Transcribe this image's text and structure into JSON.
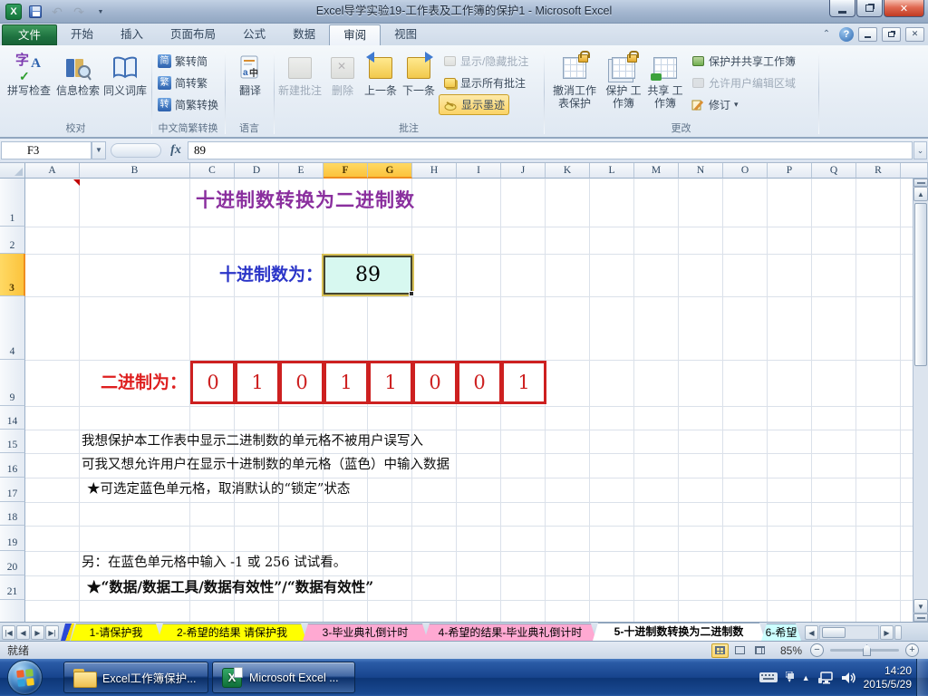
{
  "window": {
    "title": "Excel导学实验19-工作表及工作簿的保护1 - Microsoft Excel"
  },
  "ribbon": {
    "tabs": {
      "file": "文件",
      "home": "开始",
      "insert": "插入",
      "layout": "页面布局",
      "formulas": "公式",
      "data": "数据",
      "review": "审阅",
      "view": "视图"
    },
    "proofing": {
      "label": "校对",
      "spell": "拼写检查",
      "research": "信息检索",
      "thesaurus": "同义词库"
    },
    "chinese": {
      "label": "中文简繁转换",
      "t2s": "繁转简",
      "s2t": "简转繁",
      "convert": "简繁转换"
    },
    "language": {
      "label": "语言",
      "translate": "翻译"
    },
    "comments": {
      "label": "批注",
      "new": "新建批注",
      "delete": "删除",
      "prev": "上一条",
      "next": "下一条",
      "showhide": "显示/隐藏批注",
      "showall": "显示所有批注",
      "ink": "显示墨迹"
    },
    "changes": {
      "label": "更改",
      "unprotect_sheet": "撤消工作 表保护",
      "protect_wb": "保护 工作簿",
      "share_wb": "共享 工作簿",
      "protect_share": "保护并共享工作簿",
      "allow_edit": "允许用户编辑区域",
      "track": "修订"
    }
  },
  "formula_bar": {
    "name_box": "F3",
    "value": "89"
  },
  "grid": {
    "columns": [
      "A",
      "B",
      "C",
      "D",
      "E",
      "F",
      "G",
      "H",
      "I",
      "J",
      "K",
      "L",
      "M",
      "N",
      "O",
      "P",
      "Q",
      "R"
    ],
    "selected_columns": [
      "F",
      "G"
    ],
    "rows": [
      "1",
      "2",
      "3",
      "4",
      "9",
      "14",
      "15",
      "16",
      "17",
      "18",
      "19",
      "20",
      "21"
    ],
    "selected_row": "3",
    "title": "十进制数转换为二进制数",
    "decimal_label": "十进制数为：",
    "decimal_value": "89",
    "binary_label": "二进制为：",
    "binary_digits": [
      "0",
      "1",
      "0",
      "1",
      "1",
      "0",
      "0",
      "1"
    ],
    "note15": "我想保护本工作表中显示二进制数的单元格不被用户误写入",
    "note16": "可我又想允许用户在显示十进制数的单元格（蓝色）中输入数据",
    "note17": "★可选定蓝色单元格，取消默认的“锁定”状态",
    "note20": "另：在蓝色单元格中输入 -1 或 256 试试看。",
    "note21": "★“数据/数据工具/数据有效性”/“数据有效性”"
  },
  "sheet_tabs": [
    {
      "label": "1-请保护我",
      "color": "#ffff00"
    },
    {
      "label": "2-希望的结果 请保护我",
      "color": "#ffff00"
    },
    {
      "label": "3-毕业典礼倒计时",
      "color": "#ffa9d2"
    },
    {
      "label": "4-希望的结果-毕业典礼倒计时",
      "color": "#ffa9d2"
    },
    {
      "label": "5-十进制数转换为二进制数",
      "color": "#ffffff"
    },
    {
      "label": "6-希望",
      "color": "#ccffff"
    }
  ],
  "status_bar": {
    "ready": "就绪",
    "zoom": "85%"
  },
  "taskbar": {
    "app1": "Excel工作簿保护...",
    "app2": "Microsoft Excel ...",
    "clock_time": "14:20",
    "clock_date": "2015/5/29"
  },
  "icons": {
    "dropdown": "▼",
    "undo": "↶",
    "redo": "↷",
    "close": "✕",
    "help": "?",
    "collapse_ribbon": "⌃",
    "fx": "fx",
    "expand_formula": "⌄",
    "nav_first": "|◀",
    "nav_prev": "◀",
    "nav_next": "▶",
    "nav_last": "▶|",
    "scroll_up": "▲",
    "scroll_down": "▼",
    "scroll_left": "◀",
    "scroll_right": "▶",
    "caret_down": "▾",
    "minus": "−",
    "plus": "+",
    "tray_hidden": "▲",
    "chn1": "简",
    "chn2": "繁",
    "chn3": "转"
  },
  "colors": {
    "selection_header": "#fbc33c",
    "binary_red": "#cd2020",
    "title_purple": "#8a2f9e",
    "decimal_blue": "#2b35c8",
    "decimal_cell_fill": "#d7f8f0",
    "taskbar_blue": "#17448d"
  }
}
